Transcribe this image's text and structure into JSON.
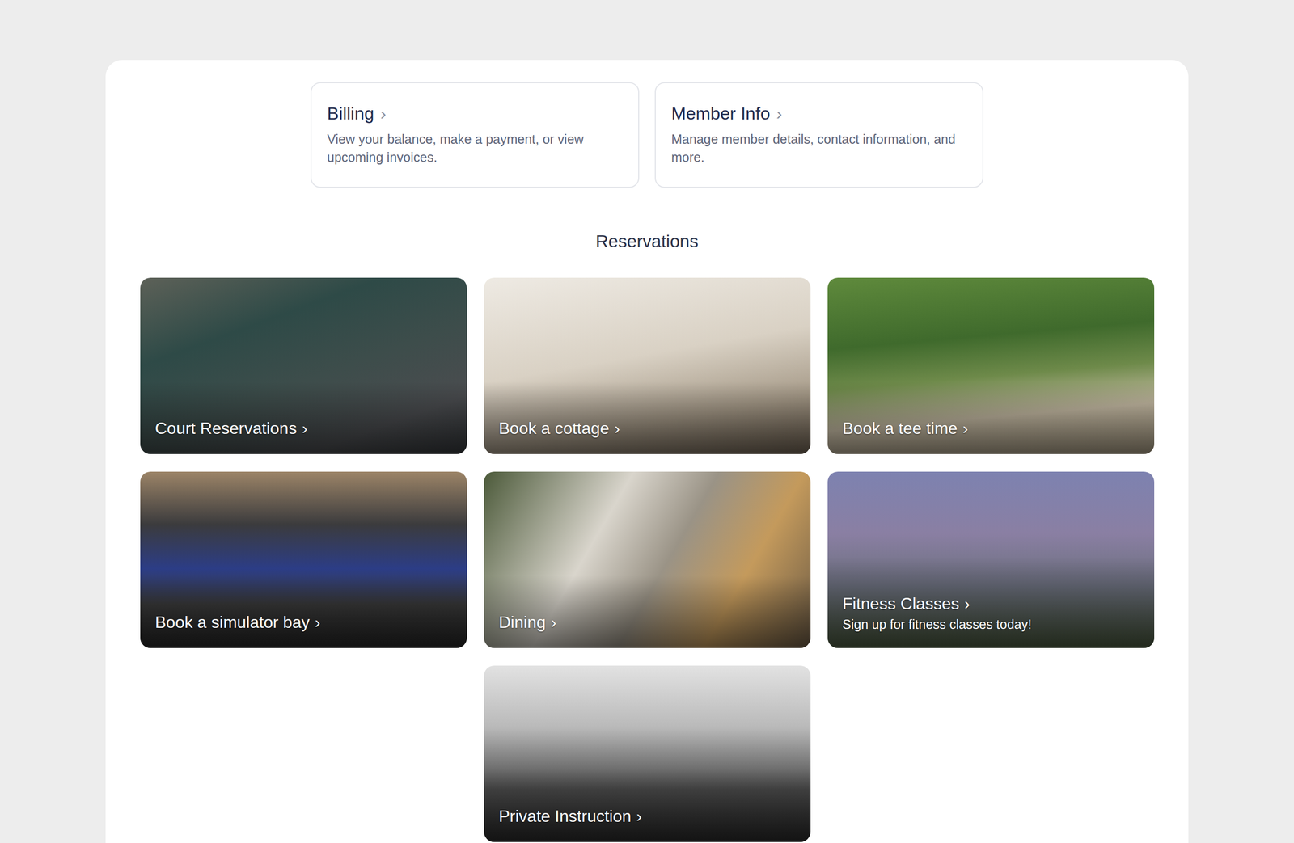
{
  "account_cards": [
    {
      "title": "Billing",
      "arrow": "›",
      "description": "View your balance, make a payment, or view upcoming invoices."
    },
    {
      "title": "Member Info",
      "arrow": "›",
      "description": "Manage member details, contact information, and more."
    }
  ],
  "reservations": {
    "heading": "Reservations",
    "tiles": [
      {
        "title": "Court Reservations",
        "arrow": "›"
      },
      {
        "title": "Book a cottage",
        "arrow": "›"
      },
      {
        "title": "Book a tee time",
        "arrow": "›"
      },
      {
        "title": "Book a simulator bay",
        "arrow": "›"
      },
      {
        "title": "Dining",
        "arrow": "›"
      },
      {
        "title": "Fitness Classes",
        "arrow": "›",
        "subtitle": "Sign up for fitness classes today!"
      },
      {
        "title": "Private Instruction",
        "arrow": "›"
      }
    ]
  }
}
